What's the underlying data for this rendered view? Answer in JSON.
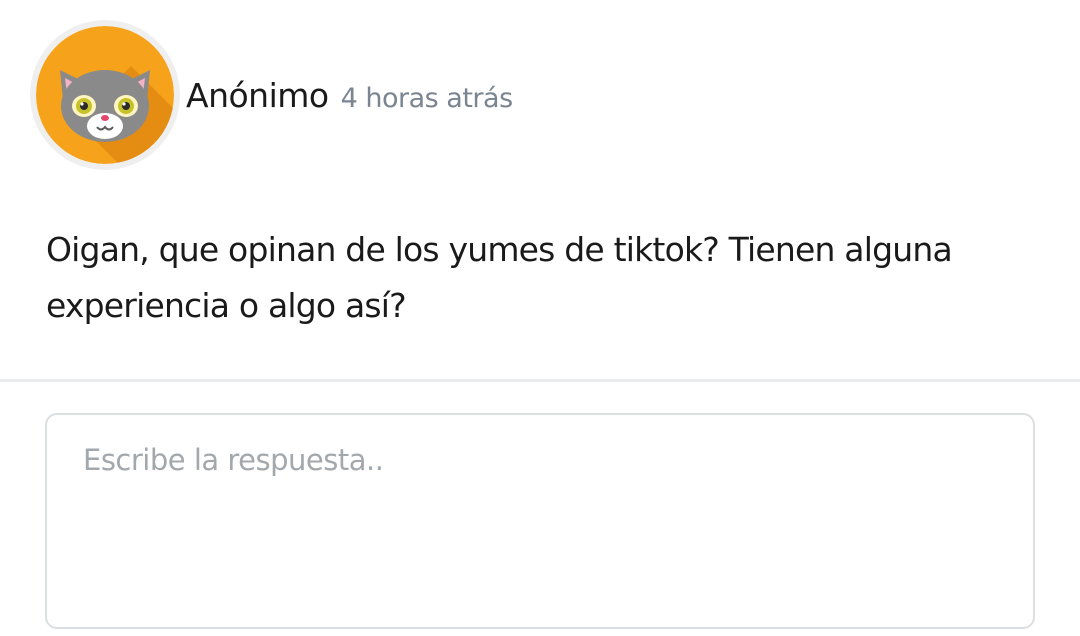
{
  "post": {
    "author": "Anónimo",
    "timestamp": "4 horas atrás",
    "avatar_icon": "cat-icon",
    "avatar_bg_color": "#f7a21b",
    "body": "Oigan, que opinan de los yumes de tiktok? Tienen alguna experiencia o algo así?"
  },
  "reply": {
    "placeholder": "Escribe la respuesta..",
    "value": ""
  }
}
